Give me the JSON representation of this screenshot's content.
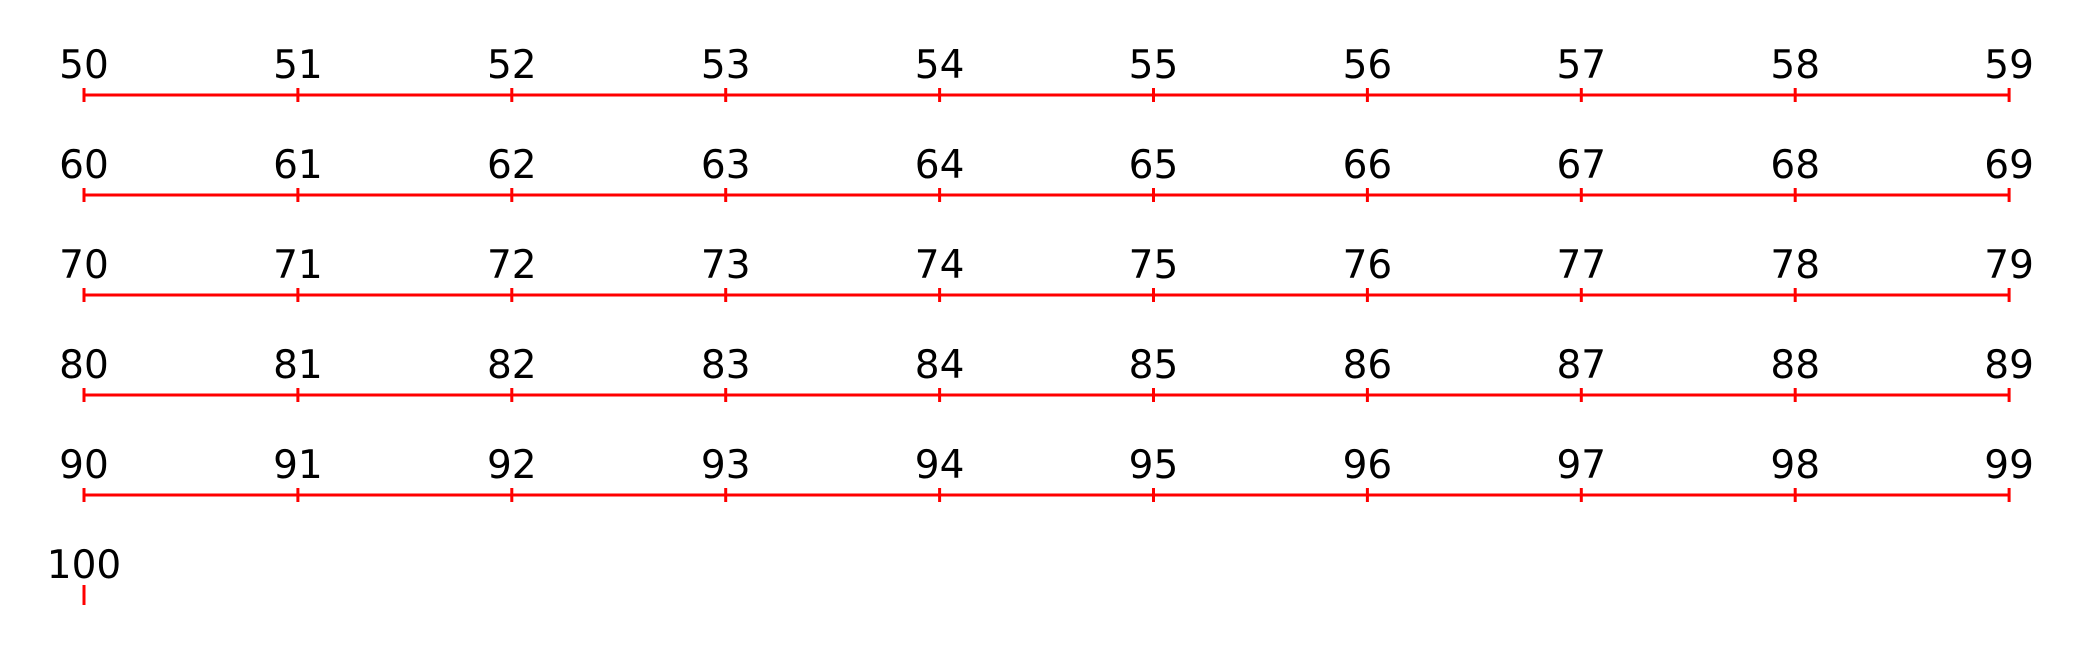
{
  "line_color": "#ff0000",
  "label_color": "#000000",
  "background_color": "#ffffff",
  "rows": [
    {
      "ticks": [
        "50",
        "51",
        "52",
        "53",
        "54",
        "55",
        "56",
        "57",
        "58",
        "59"
      ]
    },
    {
      "ticks": [
        "60",
        "61",
        "62",
        "63",
        "64",
        "65",
        "66",
        "67",
        "68",
        "69"
      ]
    },
    {
      "ticks": [
        "70",
        "71",
        "72",
        "73",
        "74",
        "75",
        "76",
        "77",
        "78",
        "79"
      ]
    },
    {
      "ticks": [
        "80",
        "81",
        "82",
        "83",
        "84",
        "85",
        "86",
        "87",
        "88",
        "89"
      ]
    },
    {
      "ticks": [
        "90",
        "91",
        "92",
        "93",
        "94",
        "95",
        "96",
        "97",
        "98",
        "99"
      ]
    },
    {
      "ticks": [
        "100"
      ]
    }
  ]
}
